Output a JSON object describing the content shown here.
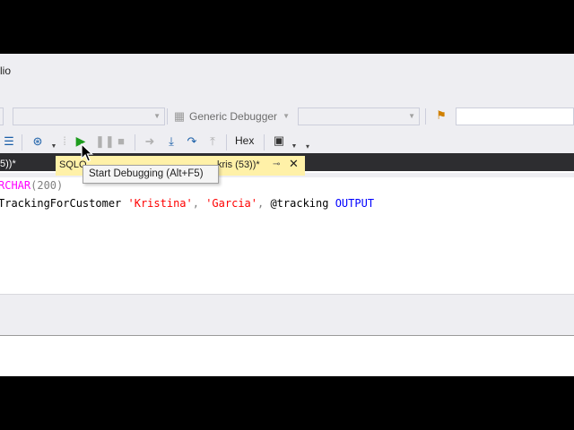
{
  "window": {
    "title": "lio"
  },
  "toolbar1": {
    "debugger_label": "Generic Debugger"
  },
  "toolbar2": {
    "hex_label": "Hex"
  },
  "tabs": {
    "left_tab_label": "5))*",
    "active_tab_prefix": "SQLQ",
    "active_tab_suffix": "kris (53))*"
  },
  "tooltip": {
    "text": "Start Debugging (Alt+F5)"
  },
  "editor": {
    "line1": {
      "type_fragment": "RCHAR",
      "args": "(200)"
    },
    "line2": {
      "proc": "TrackingForCustomer ",
      "arg1": "'Kristina'",
      "comma1": ", ",
      "arg2": "'Garcia'",
      "comma2": ", ",
      "var": "@tracking ",
      "keyword": "OUTPUT"
    }
  },
  "colors": {
    "accent_tab": "#fff1a8",
    "tabstrip": "#2d2d30",
    "run_green": "#1e9c1e"
  }
}
